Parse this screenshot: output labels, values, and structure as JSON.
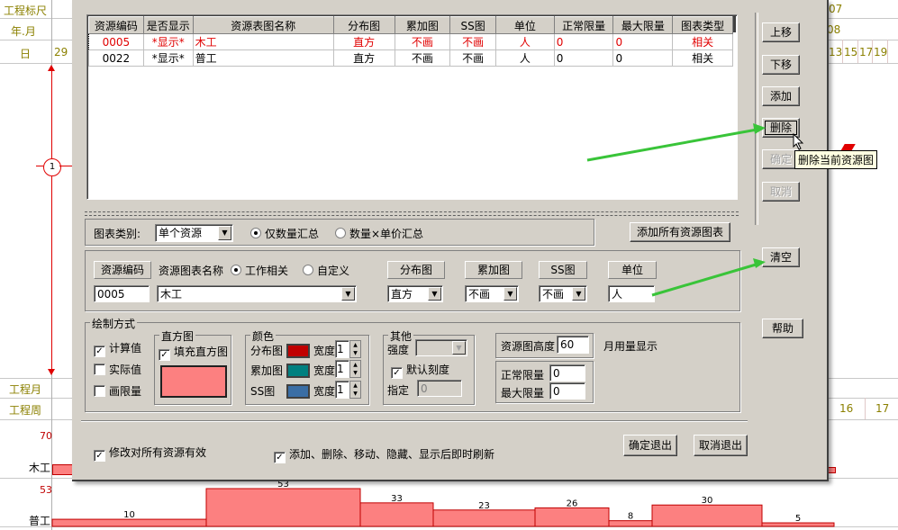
{
  "background": {
    "top_labels": [
      "工程标尺",
      "年.月",
      "日"
    ],
    "bottom_labels": [
      "工程月",
      "工程周"
    ],
    "day_left": "29",
    "year_right": "07",
    "month_right": "08",
    "days_right": [
      "13",
      "15",
      "17",
      "19"
    ],
    "week_right": [
      "16",
      "17"
    ],
    "marker": "1",
    "rows": [
      {
        "name": "木工",
        "max": "70"
      },
      {
        "name": "普工",
        "max": "53"
      }
    ],
    "bars_top_value": "53",
    "bar_labels": [
      "10",
      "33",
      "23",
      "26",
      "8",
      "30",
      "5"
    ]
  },
  "chart_data": {
    "type": "bar",
    "series": [
      {
        "name": "普工",
        "values": [
          10,
          53,
          33,
          23,
          26,
          8,
          30,
          5
        ]
      }
    ],
    "ylabel": "",
    "ymax_labels": {
      "木工": 70,
      "普工": 53
    }
  },
  "grid": {
    "headers": [
      "资源编码",
      "是否显示",
      "资源表图名称",
      "分布图",
      "累加图",
      "SS图",
      "单位",
      "正常限量",
      "最大限量",
      "图表类型"
    ],
    "rows": [
      [
        "0005",
        "*显示*",
        "木工",
        "直方",
        "不画",
        "不画",
        "人",
        "0",
        "0",
        "相关"
      ],
      [
        "0022",
        "*显示*",
        "普工",
        "直方",
        "不画",
        "不画",
        "人",
        "0",
        "0",
        "相关"
      ]
    ]
  },
  "side_buttons": {
    "up": "上移",
    "down": "下移",
    "add": "添加",
    "delete": "删除",
    "confirm": "确定",
    "cancel": "取消",
    "clear": "清空",
    "help": "帮助"
  },
  "tooltip": "删除当前资源图",
  "chart_type_row": {
    "label": "图表类别:",
    "select_value": "单个资源",
    "radio1": "仅数量汇总",
    "radio2": "数量×单价汇总",
    "add_all": "添加所有资源图表"
  },
  "resource_row": {
    "code_label": "资源编码",
    "name_label": "资源图表名称",
    "radio_work": "工作相关",
    "radio_custom": "自定义",
    "dist_label": "分布图",
    "cum_label": "累加图",
    "ss_label": "SS图",
    "unit_label": "单位",
    "code_value": "0005",
    "name_value": "木工",
    "dist_value": "直方",
    "cum_value": "不画",
    "ss_value": "不画",
    "unit_value": "人"
  },
  "draw": {
    "title": "绘制方式",
    "calc": "计算值",
    "actual": "实际值",
    "limit": "画限量",
    "hist_title": "直方图",
    "fill_hist": "填充直方图",
    "hist_color": "#fc8080"
  },
  "colors": {
    "title": "颜色",
    "dist": "分布图",
    "cum": "累加图",
    "ss": "SS图",
    "width": "宽度",
    "dist_color": "#c00000",
    "cum_color": "#008080",
    "ss_color": "#3a6ea5",
    "w1": "1",
    "w2": "1",
    "w3": "1"
  },
  "other": {
    "title": "其他",
    "strength": "强度",
    "default_scale": "默认刻度",
    "specify": "指定",
    "specify_value": "0"
  },
  "height": {
    "label": "资源图高度",
    "value": "60",
    "monthly": "月用量显示",
    "normal_label": "正常限量",
    "normal_value": "0",
    "max_label": "最大限量",
    "max_value": "0"
  },
  "bottom": {
    "apply_all": "修改对所有资源有效",
    "refresh": "添加、删除、移动、隐藏、显示后即时刷新",
    "ok": "确定退出",
    "cancel": "取消退出"
  }
}
